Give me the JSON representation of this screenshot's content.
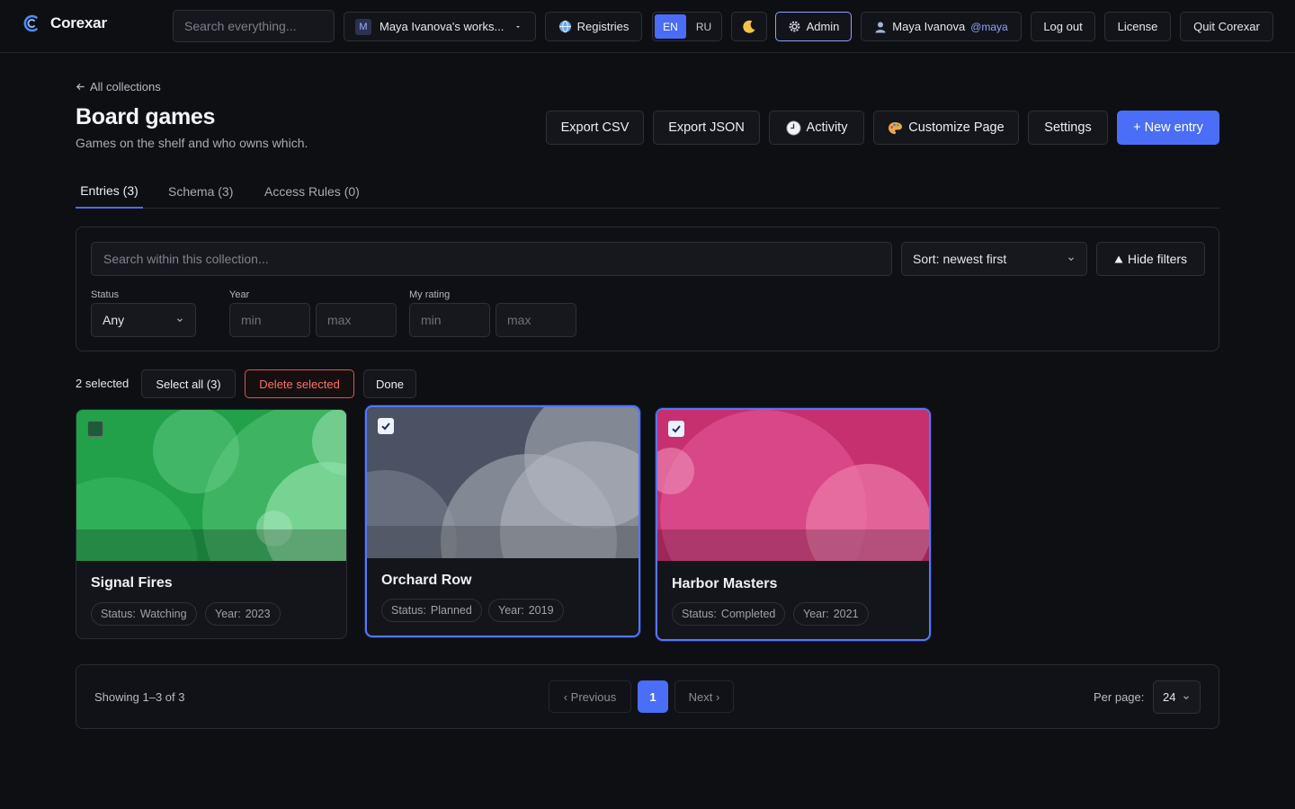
{
  "app": {
    "name": "Corexar"
  },
  "topbar": {
    "search_placeholder": "Search everything...",
    "workspace_initial": "M",
    "workspace_label": "Maya Ivanova's works...",
    "registries_label": "Registries",
    "lang_en": "EN",
    "lang_ru": "RU",
    "theme_icon": "moon-icon",
    "admin_label": "Admin",
    "user_name": "Maya Ivanova",
    "user_handle": "@maya",
    "logout_label": "Log out",
    "license_label": "License",
    "quit_label": "Quit Corexar"
  },
  "header": {
    "breadcrumb": "All collections",
    "title": "Board games",
    "subtitle": "Games on the shelf and who owns which.",
    "actions": {
      "export_csv": "Export CSV",
      "export_json": "Export JSON",
      "activity": "Activity",
      "customize": "Customize Page",
      "settings": "Settings",
      "new_entry": "+ New entry"
    }
  },
  "tabs": [
    {
      "label": "Entries (3)",
      "active": true
    },
    {
      "label": "Schema (3)",
      "active": false
    },
    {
      "label": "Access Rules (0)",
      "active": false
    }
  ],
  "filters": {
    "search_placeholder": "Search within this collection...",
    "sort_value": "Sort: newest first",
    "hide_label": "Hide filters",
    "status_label": "Status",
    "status_value": "Any",
    "year_label": "Year",
    "year_min_placeholder": "min",
    "year_max_placeholder": "max",
    "rating_label": "My rating",
    "rating_min_placeholder": "min",
    "rating_max_placeholder": "max"
  },
  "selection": {
    "count_text": "2 selected",
    "select_all": "Select all (3)",
    "delete_selected": "Delete selected",
    "done": "Done"
  },
  "cards": [
    {
      "title": "Signal Fires",
      "status_key": "Status:",
      "status": "Watching",
      "year_key": "Year:",
      "year": "2023",
      "selected": false,
      "color": "#22a04a"
    },
    {
      "title": "Orchard Row",
      "status_key": "Status:",
      "status": "Planned",
      "year_key": "Year:",
      "year": "2019",
      "selected": true,
      "color": "#5c6474"
    },
    {
      "title": "Harbor Masters",
      "status_key": "Status:",
      "status": "Completed",
      "year_key": "Year:",
      "year": "2021",
      "selected": true,
      "color": "#cf3679"
    }
  ],
  "pagination": {
    "info": "Showing 1–3 of 3",
    "previous": "‹ Previous",
    "current_page": "1",
    "next": "Next ›",
    "per_page_label": "Per page:",
    "per_page_value": "24"
  },
  "colors": {
    "accent": "#4b6ef8",
    "danger": "#e0524f",
    "background": "#0e0f13"
  }
}
